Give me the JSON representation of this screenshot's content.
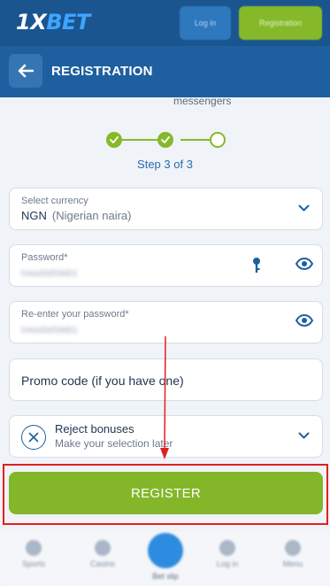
{
  "topbar": {
    "logo_prefix": "1X",
    "logo_suffix": "BET",
    "login_label": "Log in",
    "register_label": "Registration"
  },
  "header": {
    "title": "REGISTRATION",
    "back_icon": "arrow-left-icon"
  },
  "partial_text": "messengers",
  "stepper": {
    "text": "Step 3 of 3",
    "steps": [
      "done",
      "done",
      "current"
    ],
    "color": "#86b92a"
  },
  "form": {
    "currency": {
      "label": "Select currency",
      "code": "NGN",
      "name": "(Nigerian naira)"
    },
    "password": {
      "label": "Password*",
      "value": "h4wd3dS9d01"
    },
    "password_confirm": {
      "label": "Re-enter your password*",
      "value": "h4wd3dS9d01"
    },
    "promo": {
      "placeholder": "Promo code (if you have one)"
    },
    "bonus": {
      "title": "Reject bonuses",
      "subtitle": "Make your selection later"
    }
  },
  "register_button": {
    "label": "REGISTER"
  },
  "bottom_nav": {
    "items": [
      "Sports",
      "Casino",
      "Bet slip",
      "Log in",
      "Menu"
    ]
  },
  "colors": {
    "brand_blue": "#1e5f9f",
    "accent_green": "#84b62a",
    "annotation_red": "#e02020"
  }
}
